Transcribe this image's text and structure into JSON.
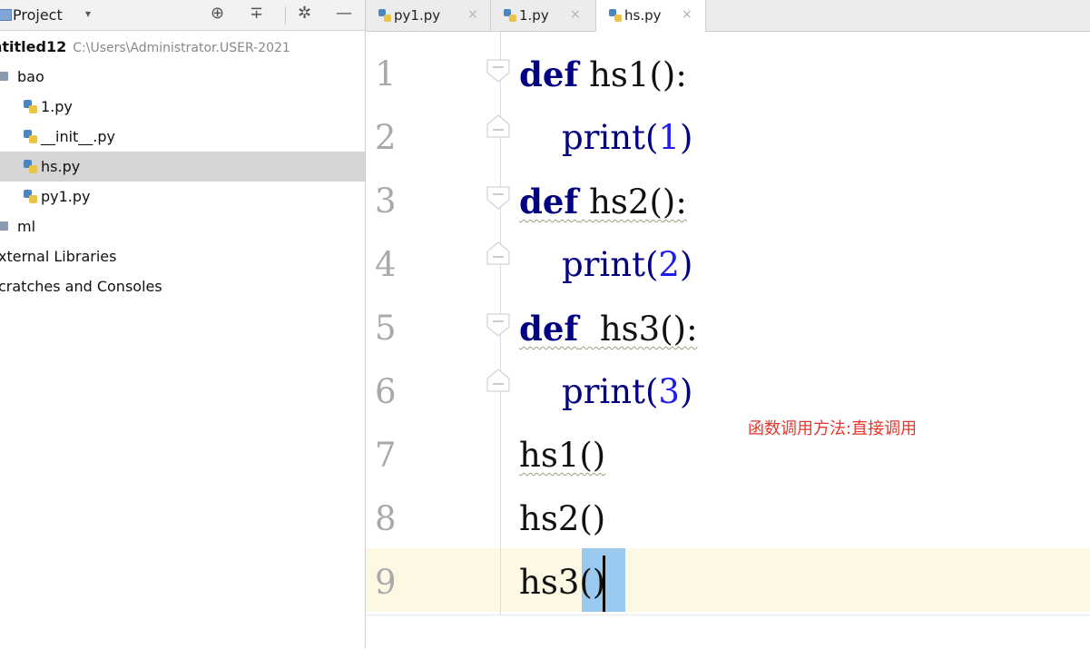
{
  "project_panel": {
    "title": "Project",
    "caret": "▾",
    "icons": [
      "target-icon",
      "collapse-all-icon",
      "gear-icon",
      "minimize-icon"
    ],
    "root": {
      "name": "ntitled12",
      "path": "C:\\Users\\Administrator.USER-2021"
    },
    "items": [
      {
        "label": "bao",
        "type": "folder"
      },
      {
        "label": "1.py",
        "type": "file"
      },
      {
        "label": "__init__.py",
        "type": "file"
      },
      {
        "label": "hs.py",
        "type": "file"
      },
      {
        "label": "py1.py",
        "type": "file"
      },
      {
        "label": "ml",
        "type": "folder"
      },
      {
        "label": "xternal Libraries",
        "type": "other"
      },
      {
        "label": "cratches and Consoles",
        "type": "other"
      }
    ]
  },
  "tabs": [
    {
      "label": "py1.py",
      "active": false
    },
    {
      "label": "1.py",
      "active": false
    },
    {
      "label": "hs.py",
      "active": true
    }
  ],
  "tab_close": "×",
  "editor": {
    "line_numbers": [
      "1",
      "2",
      "3",
      "4",
      "5",
      "6",
      "7",
      "8",
      "9"
    ],
    "lines": [
      {
        "kw": "def",
        "rest": " hs1():"
      },
      {
        "indent": "    ",
        "bi": "print",
        "open": "(",
        "num": "1",
        "close": ")"
      },
      {
        "kw": "def",
        "rest": " hs2():"
      },
      {
        "indent": "    ",
        "bi": "print",
        "open": "(",
        "num": "2",
        "close": ")"
      },
      {
        "kw": "def",
        "rest": "  hs3():"
      },
      {
        "indent": "    ",
        "bi": "print",
        "open": "(",
        "num": "3",
        "close": ")"
      },
      {
        "plain": "hs1()"
      },
      {
        "plain": "hs2()"
      },
      {
        "plain": "hs3()"
      }
    ],
    "annotation": "函数调用方法:直接调用",
    "colors": {
      "keyword": "#000080",
      "number": "#1e1ef0",
      "annotation": "#e8352a",
      "caret_line": "#fcf8e3",
      "bracket_highlight": "#99c9ef"
    }
  }
}
